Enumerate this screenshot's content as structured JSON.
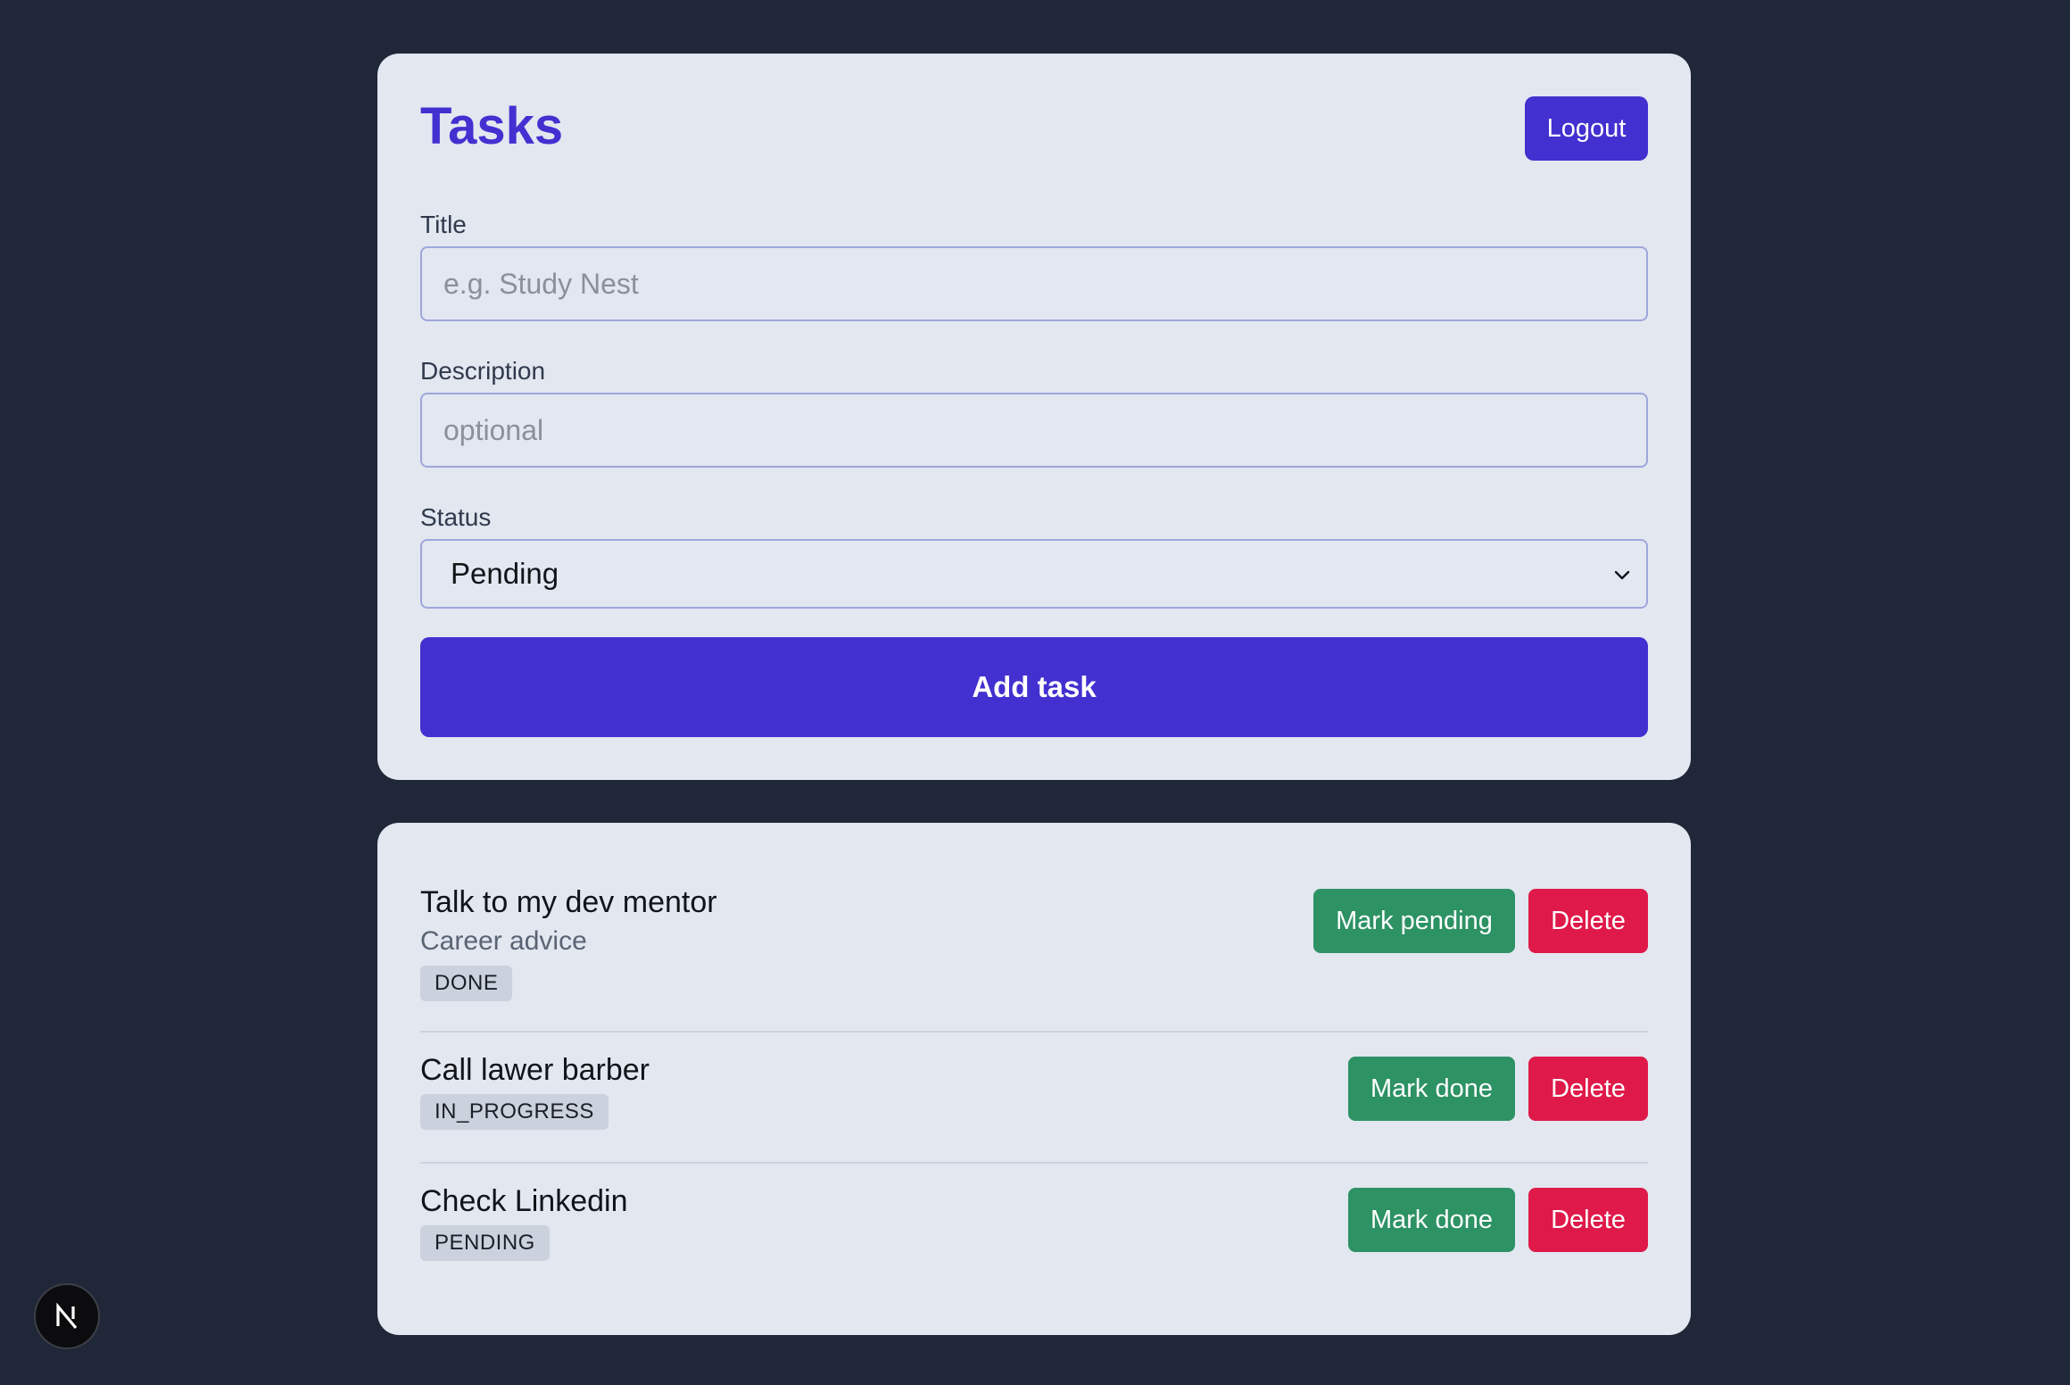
{
  "header": {
    "title": "Tasks",
    "logout_label": "Logout"
  },
  "form": {
    "title_label": "Title",
    "title_placeholder": "e.g. Study Nest",
    "description_label": "Description",
    "description_placeholder": "optional",
    "status_label": "Status",
    "status_selected": "Pending",
    "submit_label": "Add task"
  },
  "tasks": [
    {
      "title": "Talk to my dev mentor",
      "description": "Career advice",
      "status": "DONE",
      "toggle_label": "Mark pending",
      "delete_label": "Delete"
    },
    {
      "title": "Call lawer barber",
      "status": "IN_PROGRESS",
      "toggle_label": "Mark done",
      "delete_label": "Delete"
    },
    {
      "title": "Check Linkedin",
      "status": "PENDING",
      "toggle_label": "Mark done",
      "delete_label": "Delete"
    }
  ],
  "colors": {
    "background": "#1f2738",
    "card": "#e2e7f0",
    "accent": "#4330d0",
    "success": "#2d9264",
    "danger": "#df1a4a"
  },
  "icons": {
    "dev_badge": "nextjs-logo-icon",
    "select": "chevron-down-icon"
  }
}
